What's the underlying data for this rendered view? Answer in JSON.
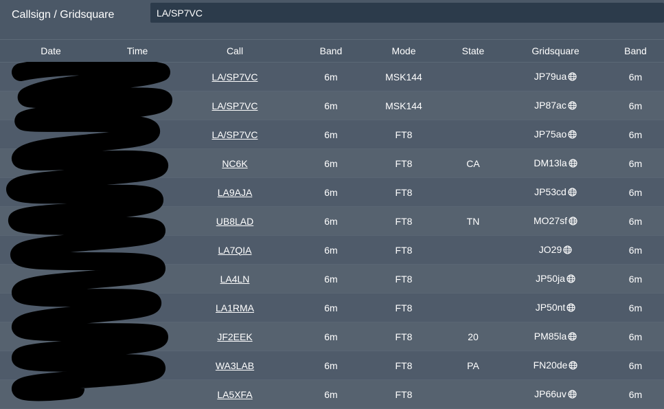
{
  "search": {
    "label": "Callsign / Gridsquare",
    "value": "LA/SP7VC"
  },
  "table": {
    "headers": {
      "date": "Date",
      "time": "Time",
      "call": "Call",
      "band": "Band",
      "mode": "Mode",
      "state": "State",
      "gridsquare": "Gridsquare",
      "band2": "Band"
    },
    "rows": [
      {
        "date": "",
        "time": "",
        "call": "LA/SP7VC",
        "band": "6m",
        "mode": "MSK144",
        "state": "",
        "gridsquare": "JP79ua",
        "band2": "6m"
      },
      {
        "date": "",
        "time": "",
        "call": "LA/SP7VC",
        "band": "6m",
        "mode": "MSK144",
        "state": "",
        "gridsquare": "JP87ac",
        "band2": "6m"
      },
      {
        "date": "",
        "time": "",
        "call": "LA/SP7VC",
        "band": "6m",
        "mode": "FT8",
        "state": "",
        "gridsquare": "JP75ao",
        "band2": "6m"
      },
      {
        "date": "",
        "time": "",
        "call": "NC6K",
        "band": "6m",
        "mode": "FT8",
        "state": "CA",
        "gridsquare": "DM13la",
        "band2": "6m"
      },
      {
        "date": "",
        "time": "",
        "call": "LA9AJA",
        "band": "6m",
        "mode": "FT8",
        "state": "",
        "gridsquare": "JP53cd",
        "band2": "6m"
      },
      {
        "date": "",
        "time": "",
        "call": "UB8LAD",
        "band": "6m",
        "mode": "FT8",
        "state": "TN",
        "gridsquare": "MO27sf",
        "band2": "6m"
      },
      {
        "date": "",
        "time": "",
        "call": "LA7QIA",
        "band": "6m",
        "mode": "FT8",
        "state": "",
        "gridsquare": "JO29",
        "band2": "6m"
      },
      {
        "date": "",
        "time": "",
        "call": "LA4LN",
        "band": "6m",
        "mode": "FT8",
        "state": "",
        "gridsquare": "JP50ja",
        "band2": "6m"
      },
      {
        "date": "",
        "time": "",
        "call": "LA1RMA",
        "band": "6m",
        "mode": "FT8",
        "state": "",
        "gridsquare": "JP50nt",
        "band2": "6m"
      },
      {
        "date": "",
        "time": "",
        "call": "JF2EEK",
        "band": "6m",
        "mode": "FT8",
        "state": "20",
        "gridsquare": "PM85la",
        "band2": "6m"
      },
      {
        "date": "",
        "time": "",
        "call": "WA3LAB",
        "band": "6m",
        "mode": "FT8",
        "state": "PA",
        "gridsquare": "FN20de",
        "band2": "6m"
      },
      {
        "date": "",
        "time": "",
        "call": "LA5XFA",
        "band": "6m",
        "mode": "FT8",
        "state": "",
        "gridsquare": "JP66uv",
        "band2": "6m"
      }
    ]
  },
  "icons": {
    "gridsquare_map": "globe-icon"
  },
  "colors": {
    "background": "#4b5867",
    "input_background": "#2c3b4b",
    "row_odd": "#4f5b6a",
    "row_even": "#56626f",
    "redaction": "#000000"
  }
}
